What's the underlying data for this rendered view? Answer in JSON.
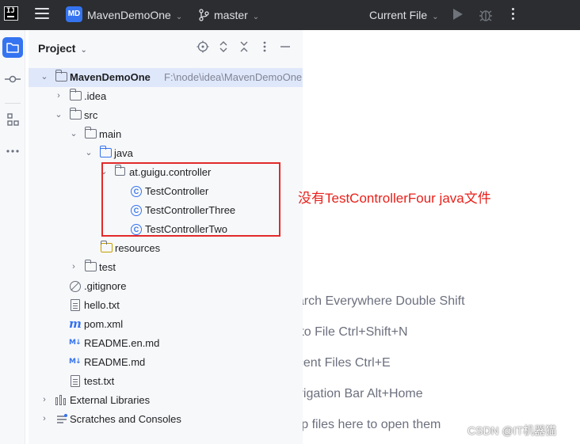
{
  "titlebar": {
    "app_icon": "intellij-logo",
    "logo_text": "IJ",
    "menu_icon": "hamburger-icon",
    "project_badge": "MD",
    "project_name": "MavenDemoOne",
    "branch_icon": "git-branch-icon",
    "branch": "master",
    "run_config": "Current File",
    "run_icon": "play-icon",
    "debug_icon": "bug-icon",
    "more_icon": "more-vertical-icon"
  },
  "toolstrip": {
    "items": [
      "folder-icon",
      "commit-icon",
      "structure-icon",
      "more-horizontal-icon"
    ],
    "active": "folder-icon"
  },
  "panel": {
    "title": "Project",
    "header_icons": [
      "locate-icon",
      "expand-all-icon",
      "collapse-all-icon",
      "options-icon",
      "hide-icon"
    ]
  },
  "tree": {
    "root_label": "MavenDemoOne",
    "root_path": "F:\\node\\idea\\MavenDemoOne",
    "idea": ".idea",
    "src": "src",
    "main": "main",
    "java": "java",
    "package": "at.guigu.controller",
    "class1": "TestController",
    "class2": "TestControllerThree",
    "class3": "TestControllerTwo",
    "resources": "resources",
    "test": "test",
    "gitignore": ".gitignore",
    "hello": "hello.txt",
    "pom": "pom.xml",
    "readme_en": "README.en.md",
    "readme": "README.md",
    "testtxt": "test.txt",
    "ext_libs": "External Libraries",
    "scratches": "Scratches and Consoles"
  },
  "annotation": {
    "text": "没有TestControllerFour java文件",
    "color": "#e8201a"
  },
  "editor_hints": {
    "search": "earch Everywhere Double Shift",
    "goto": "o to File Ctrl+Shift+N",
    "recent": "ecent Files Ctrl+E",
    "navbar": "avigation Bar Alt+Home",
    "drop": "rop files here to open them"
  },
  "watermark": "CSDN @IT机器猫",
  "colors": {
    "titlebar_bg": "#2b2d30",
    "accent": "#3574f0",
    "selection": "#dfe8fb",
    "panel_bg": "#f7f8fa",
    "annotation_border": "#e22a2a"
  }
}
